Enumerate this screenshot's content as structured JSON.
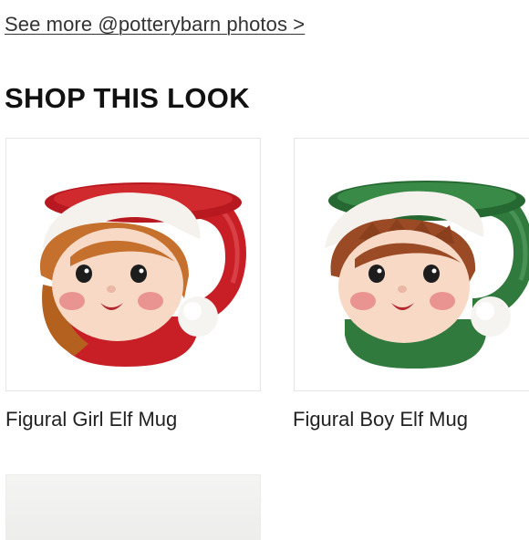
{
  "see_more_link": "See more @potterybarn photos >",
  "section_title": "SHOP THIS LOOK",
  "products": [
    {
      "name": "Figural Girl Elf Mug",
      "accent": "#c81f26",
      "hair": "#c6702e"
    },
    {
      "name": "Figural Boy Elf Mug",
      "accent": "#2f7a3c",
      "hair": "#9a4a24"
    }
  ]
}
